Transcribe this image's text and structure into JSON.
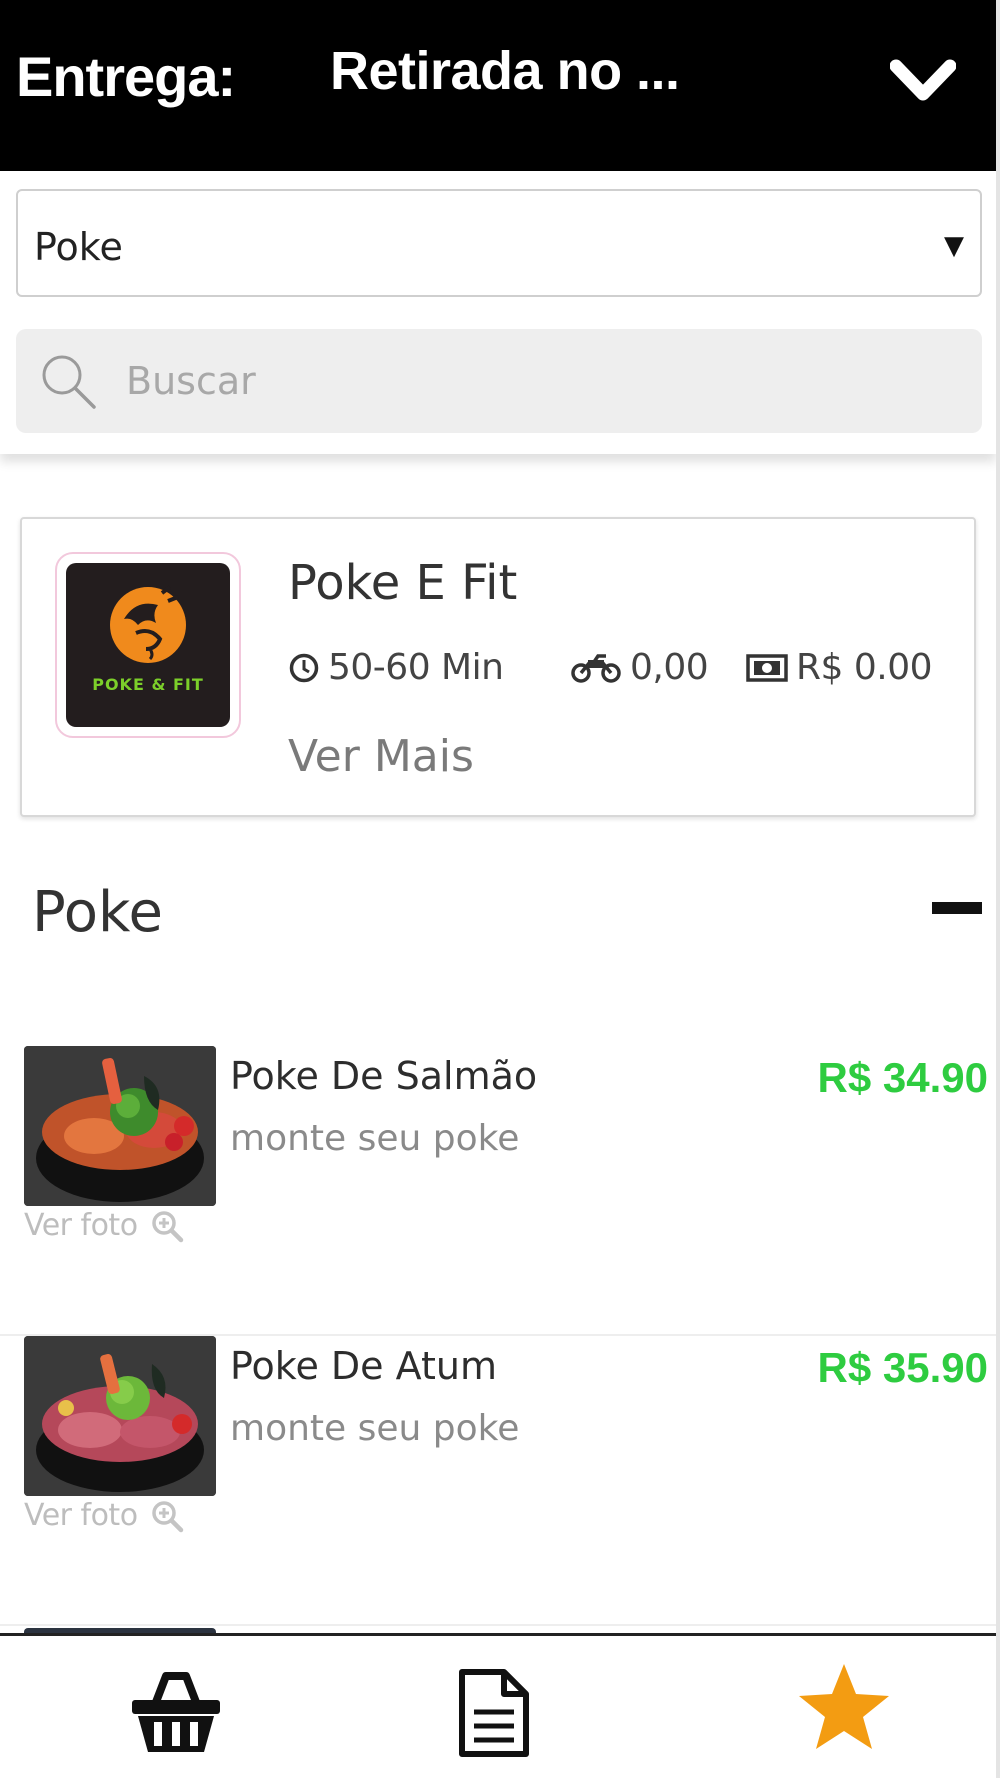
{
  "header": {
    "delivery_label": "Entrega:",
    "delivery_value": "Retirada no ...",
    "dropdown_icon": "chevron-down-icon"
  },
  "category_select": {
    "selected": "Poke",
    "arrow": "▼"
  },
  "search": {
    "placeholder": "Buscar",
    "value": "",
    "icon": "search-icon"
  },
  "store": {
    "logo_text": "POKE & FIT",
    "name": "Poke E Fit",
    "time": "50-60 Min",
    "delivery_fee": "0,00",
    "min_order": "R$ 0.00",
    "more_label": "Ver Mais",
    "colors": {
      "logo_bg": "#231d1e",
      "logo_orange": "#f08a1c",
      "logo_green": "#7ccf2a"
    }
  },
  "section": {
    "title": "Poke",
    "collapse_icon": "minus-icon"
  },
  "products": [
    {
      "name": "Poke De Salmão",
      "description": "monte seu poke",
      "price": "R$ 34.90",
      "photo_label": "Ver foto"
    },
    {
      "name": "Poke De Atum",
      "description": "monte seu poke",
      "price": "R$ 35.90",
      "photo_label": "Ver foto"
    }
  ],
  "bottom_nav": {
    "items": [
      {
        "icon": "basket-icon"
      },
      {
        "icon": "document-icon"
      },
      {
        "icon": "star-icon",
        "color": "#f39c12"
      }
    ]
  },
  "colors": {
    "header_bg": "#000000",
    "price": "#2ecc40",
    "accent_star": "#f39c12"
  }
}
